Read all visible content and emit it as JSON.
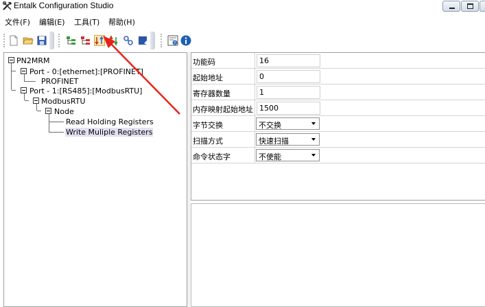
{
  "window": {
    "title": "Entalk Configuration Studio",
    "controls": [
      "minimize",
      "maximize",
      "close"
    ]
  },
  "menu": {
    "items": [
      {
        "label": "文件(F)"
      },
      {
        "label": "编辑(E)"
      },
      {
        "label": "工具(T)"
      },
      {
        "label": "帮助(H)"
      }
    ]
  },
  "toolbar": {
    "buttons": [
      {
        "icon": "new-file-icon"
      },
      {
        "icon": "open-folder-icon"
      },
      {
        "icon": "save-icon"
      },
      {
        "icon": "tree-add-icon"
      },
      {
        "icon": "tree-remove-icon"
      },
      {
        "icon": "download-icon",
        "highlighted": true
      },
      {
        "icon": "upload-icon"
      },
      {
        "icon": "link-icon"
      },
      {
        "icon": "edit-icon"
      },
      {
        "icon": "help-icon"
      },
      {
        "icon": "info-icon"
      }
    ]
  },
  "tree": {
    "nodes": [
      {
        "label": "PN2MRM"
      },
      {
        "label": "Port - 0:[ethernet]:[PROFINET]"
      },
      {
        "label": "PROFINET"
      },
      {
        "label": "Port - 1:[RS485]:[ModbusRTU]"
      },
      {
        "label": "ModbusRTU"
      },
      {
        "label": "Node"
      },
      {
        "label": "Read Holding Registers"
      },
      {
        "label": "Write Muliple Registers",
        "selected": true
      }
    ]
  },
  "properties": {
    "rows": [
      {
        "label": "功能码",
        "value": "16",
        "kind": "text"
      },
      {
        "label": "起始地址",
        "value": "0",
        "kind": "text"
      },
      {
        "label": "寄存器数量",
        "value": "1",
        "kind": "text"
      },
      {
        "label": "内存映射起始地址",
        "value": "1500",
        "kind": "text"
      },
      {
        "label": "字节交换",
        "value": "不交换",
        "kind": "select"
      },
      {
        "label": "扫描方式",
        "value": "快速扫描",
        "kind": "select"
      },
      {
        "label": "命令状态字",
        "value": "不使能",
        "kind": "select"
      }
    ]
  },
  "colors": {
    "selection": "#e3e0f3",
    "annotation_arrow": "#e8221b",
    "border": "#a0a0a0"
  }
}
